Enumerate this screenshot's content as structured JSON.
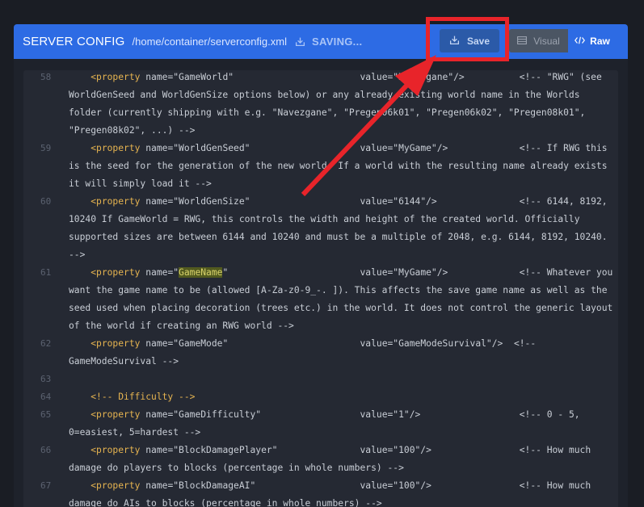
{
  "header": {
    "title": "SERVER CONFIG",
    "path": "/home/container/serverconfig.xml",
    "saving_label": "SAVING..."
  },
  "toolbar": {
    "save_label": "Save",
    "visual_label": "Visual",
    "raw_label": "Raw"
  },
  "colors": {
    "header": "#2d6be4",
    "highlight": "#e8242a",
    "tag": "#e6b450"
  },
  "editor": {
    "lines": [
      {
        "num": "58",
        "tag": "<property",
        "attr": " name=\"",
        "val": "GameWorld",
        "rest": "\"                       value=\"Navezgane\"/>          <!-- \"RWG\" (see WorldGenSeed and WorldGenSize options below) or any already existing world name in the Worlds folder (currently shipping with e.g. \"Navezgane\", \"Pregen06k01\", \"Pregen06k02\", \"Pregen08k01\", \"Pregen08k02\", ...) -->"
      },
      {
        "num": "59",
        "tag": "<property",
        "attr": " name=\"",
        "val": "WorldGenSeed",
        "rest": "\"                    value=\"MyGame\"/>             <!-- If RWG this is the seed for the generation of the new world. If a world with the resulting name already exists it will simply load it -->"
      },
      {
        "num": "60",
        "tag": "<property",
        "attr": " name=\"",
        "val": "WorldGenSize",
        "rest": "\"                    value=\"6144\"/>               <!-- 6144, 8192, 10240 If GameWorld = RWG, this controls the width and height of the created world. Officially supported sizes are between 6144 and 10240 and must be a multiple of 2048, e.g. 6144, 8192, 10240. -->"
      },
      {
        "num": "61",
        "tag": "<property",
        "attr": " name=\"",
        "val": "GameName",
        "rest": "\"                        value=\"MyGame\"/>             <!-- Whatever you want the game name to be (allowed [A-Za-z0-9_-. ]). This affects the save game name as well as the seed used when placing decoration (trees etc.) in the world. It does not control the generic layout of the world if creating an RWG world -->"
      },
      {
        "num": "62",
        "tag": "<property",
        "attr": " name=\"",
        "val": "GameMode",
        "rest": "\"                        value=\"GameModeSurvival\"/>  <!-- GameModeSurvival -->"
      },
      {
        "num": "63",
        "tag": "",
        "attr": "",
        "val": "",
        "rest": ""
      },
      {
        "num": "64",
        "tag": "<!-- Difficulty -->",
        "attr": "",
        "val": "",
        "rest": ""
      },
      {
        "num": "65",
        "tag": "<property",
        "attr": " name=\"",
        "val": "GameDifficulty",
        "rest": "\"                  value=\"1\"/>                  <!-- 0 - 5, 0=easiest, 5=hardest -->"
      },
      {
        "num": "66",
        "tag": "<property",
        "attr": " name=\"",
        "val": "BlockDamagePlayer",
        "rest": "\"               value=\"100\"/>                <!-- How much damage do players to blocks (percentage in whole numbers) -->"
      },
      {
        "num": "67",
        "tag": "<property",
        "attr": " name=\"",
        "val": "BlockDamageAI",
        "rest": "\"                   value=\"100\"/>                <!-- How much damage do AIs to blocks (percentage in whole numbers) -->"
      }
    ]
  }
}
